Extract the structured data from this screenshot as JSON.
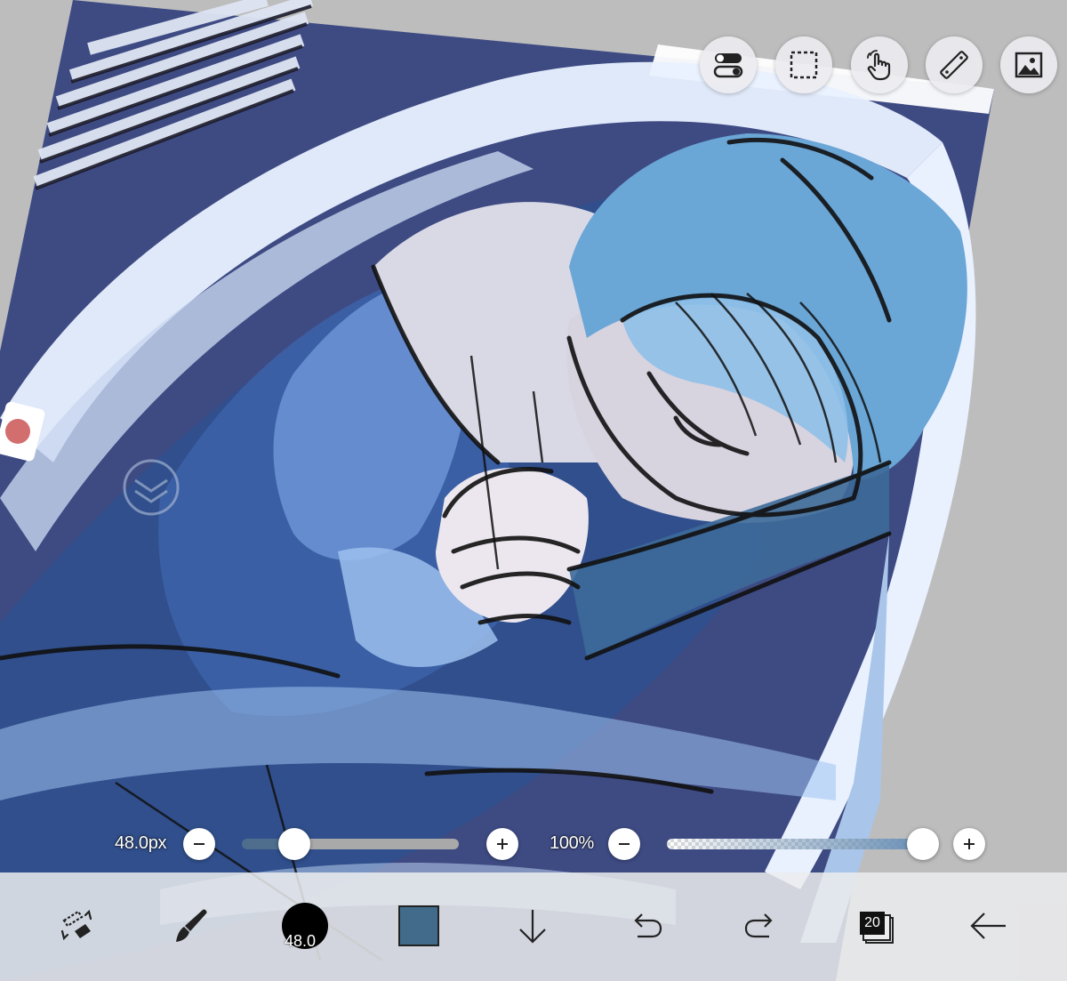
{
  "top_tools": [
    {
      "name": "toggle-icon",
      "label": ""
    },
    {
      "name": "selection-icon",
      "label": ""
    },
    {
      "name": "hand-touch-icon",
      "label": ""
    },
    {
      "name": "ruler-icon",
      "label": ""
    },
    {
      "name": "image-icon",
      "label": ""
    }
  ],
  "brush_size": {
    "label": "48.0px",
    "value_fraction": 0.24,
    "fill_color": "#4f6d8c",
    "rest_color": "#a9a9a9"
  },
  "opacity": {
    "label": "100%",
    "value_fraction": 1.0,
    "fill_color": "#6a8fb5"
  },
  "bottom_bar": {
    "tools": [
      {
        "name": "transform-tool-icon"
      },
      {
        "name": "brush-icon"
      },
      {
        "name": "brush-size-indicator",
        "text": "48.0"
      },
      {
        "name": "color-swatch",
        "color": "#426b8b"
      },
      {
        "name": "download-arrow-icon"
      },
      {
        "name": "undo-icon"
      },
      {
        "name": "redo-icon"
      },
      {
        "name": "layers-icon",
        "text": "20"
      },
      {
        "name": "back-arrow-icon"
      }
    ]
  },
  "colors": {
    "art_navy": "#3e4b83",
    "art_blue": "#2f4f8d",
    "hair_blue": "#6aa6d6",
    "skin": "#d9d9e6",
    "highlight": "#e9f1ff"
  }
}
